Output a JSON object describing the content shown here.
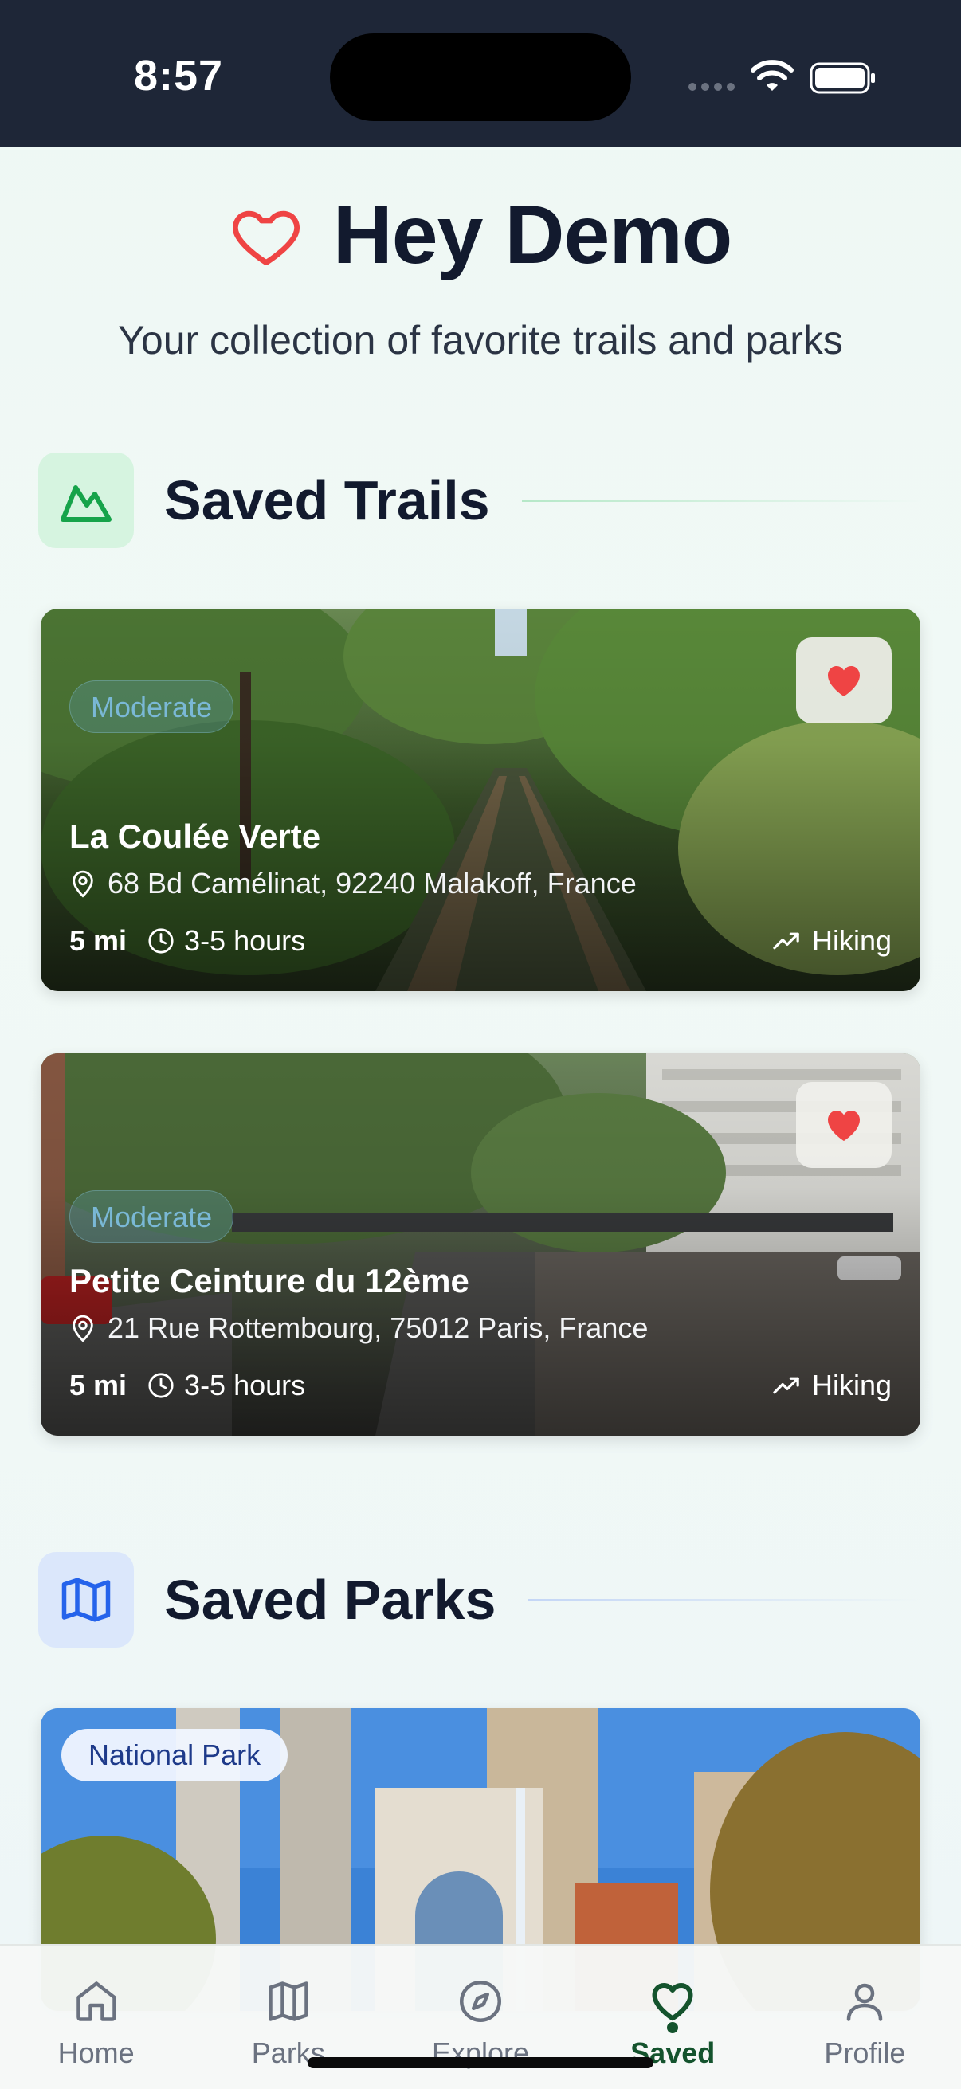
{
  "status_bar": {
    "time": "8:57"
  },
  "header": {
    "title": "Hey Demo",
    "subtitle": "Your collection of favorite trails and parks"
  },
  "sections": {
    "trails": {
      "title": "Saved Trails",
      "icon": "mountain-icon"
    },
    "parks": {
      "title": "Saved Parks",
      "icon": "map-icon"
    }
  },
  "trails": [
    {
      "difficulty": "Moderate",
      "name": "La Coulée Verte",
      "address": "68 Bd Camélinat, 92240 Malakoff, France",
      "distance": "5 mi",
      "duration": "3-5 hours",
      "activity": "Hiking"
    },
    {
      "difficulty": "Moderate",
      "name": "Petite Ceinture du 12ème",
      "address": "21 Rue Rottembourg, 75012 Paris, France",
      "distance": "5 mi",
      "duration": "3-5 hours",
      "activity": "Hiking"
    }
  ],
  "parks": [
    {
      "badge": "National Park"
    }
  ],
  "tabs": [
    {
      "label": "Home",
      "icon": "home-icon"
    },
    {
      "label": "Parks",
      "icon": "map-icon"
    },
    {
      "label": "Explore",
      "icon": "compass-icon"
    },
    {
      "label": "Saved",
      "icon": "heart-icon",
      "active": true
    },
    {
      "label": "Profile",
      "icon": "user-icon"
    }
  ],
  "colors": {
    "accent_green": "#14532d",
    "heart_red": "#ef4444",
    "status_bar_bg": "#1e2637"
  }
}
